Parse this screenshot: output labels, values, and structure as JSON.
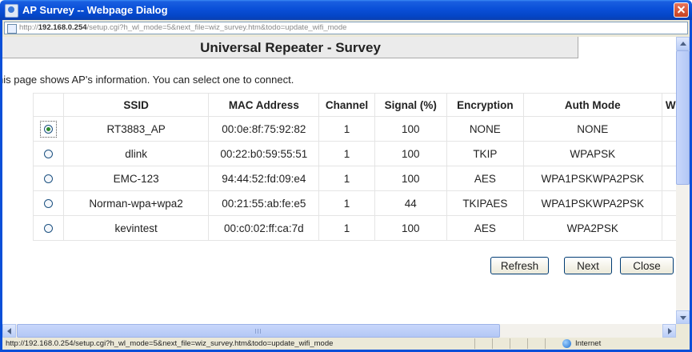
{
  "window": {
    "title": "AP Survey -- Webpage Dialog",
    "address_prefix": "http://",
    "address_host": "192.168.0.254",
    "address_path": "/setup.cgi?h_wl_mode=5&next_file=wiz_survey.htm&todo=update_wifi_mode"
  },
  "page": {
    "title": "Universal Repeater - Survey",
    "intro": "his page shows AP's information. You can select one to connect."
  },
  "table": {
    "headers": [
      "",
      "SSID",
      "MAC Address",
      "Channel",
      "Signal (%)",
      "Encryption",
      "Auth Mode",
      "W"
    ],
    "rows": [
      {
        "selected": true,
        "ssid": "RT3883_AP",
        "mac": "00:0e:8f:75:92:82",
        "channel": "1",
        "signal": "100",
        "encryption": "NONE",
        "auth": "NONE"
      },
      {
        "selected": false,
        "ssid": "dlink",
        "mac": "00:22:b0:59:55:51",
        "channel": "1",
        "signal": "100",
        "encryption": "TKIP",
        "auth": "WPAPSK"
      },
      {
        "selected": false,
        "ssid": "EMC-123",
        "mac": "94:44:52:fd:09:e4",
        "channel": "1",
        "signal": "100",
        "encryption": "AES",
        "auth": "WPA1PSKWPA2PSK"
      },
      {
        "selected": false,
        "ssid": "Norman-wpa+wpa2",
        "mac": "00:21:55:ab:fe:e5",
        "channel": "1",
        "signal": "44",
        "encryption": "TKIPAES",
        "auth": "WPA1PSKWPA2PSK"
      },
      {
        "selected": false,
        "ssid": "kevintest",
        "mac": "00:c0:02:ff:ca:7d",
        "channel": "1",
        "signal": "100",
        "encryption": "AES",
        "auth": "WPA2PSK"
      }
    ]
  },
  "buttons": {
    "refresh": "Refresh",
    "next": "Next",
    "close": "Close"
  },
  "status": {
    "url": "http://192.168.0.254/setup.cgi?h_wl_mode=5&next_file=wiz_survey.htm&todo=update_wifi_mode",
    "zone": "Internet"
  },
  "icons": {
    "title": "ie-dialog-icon",
    "address": "page-icon",
    "zone": "globe-icon",
    "close": "close-icon"
  },
  "colors": {
    "titlebar": "#0a4fd8",
    "selected_radio": "#2c8a2c"
  }
}
